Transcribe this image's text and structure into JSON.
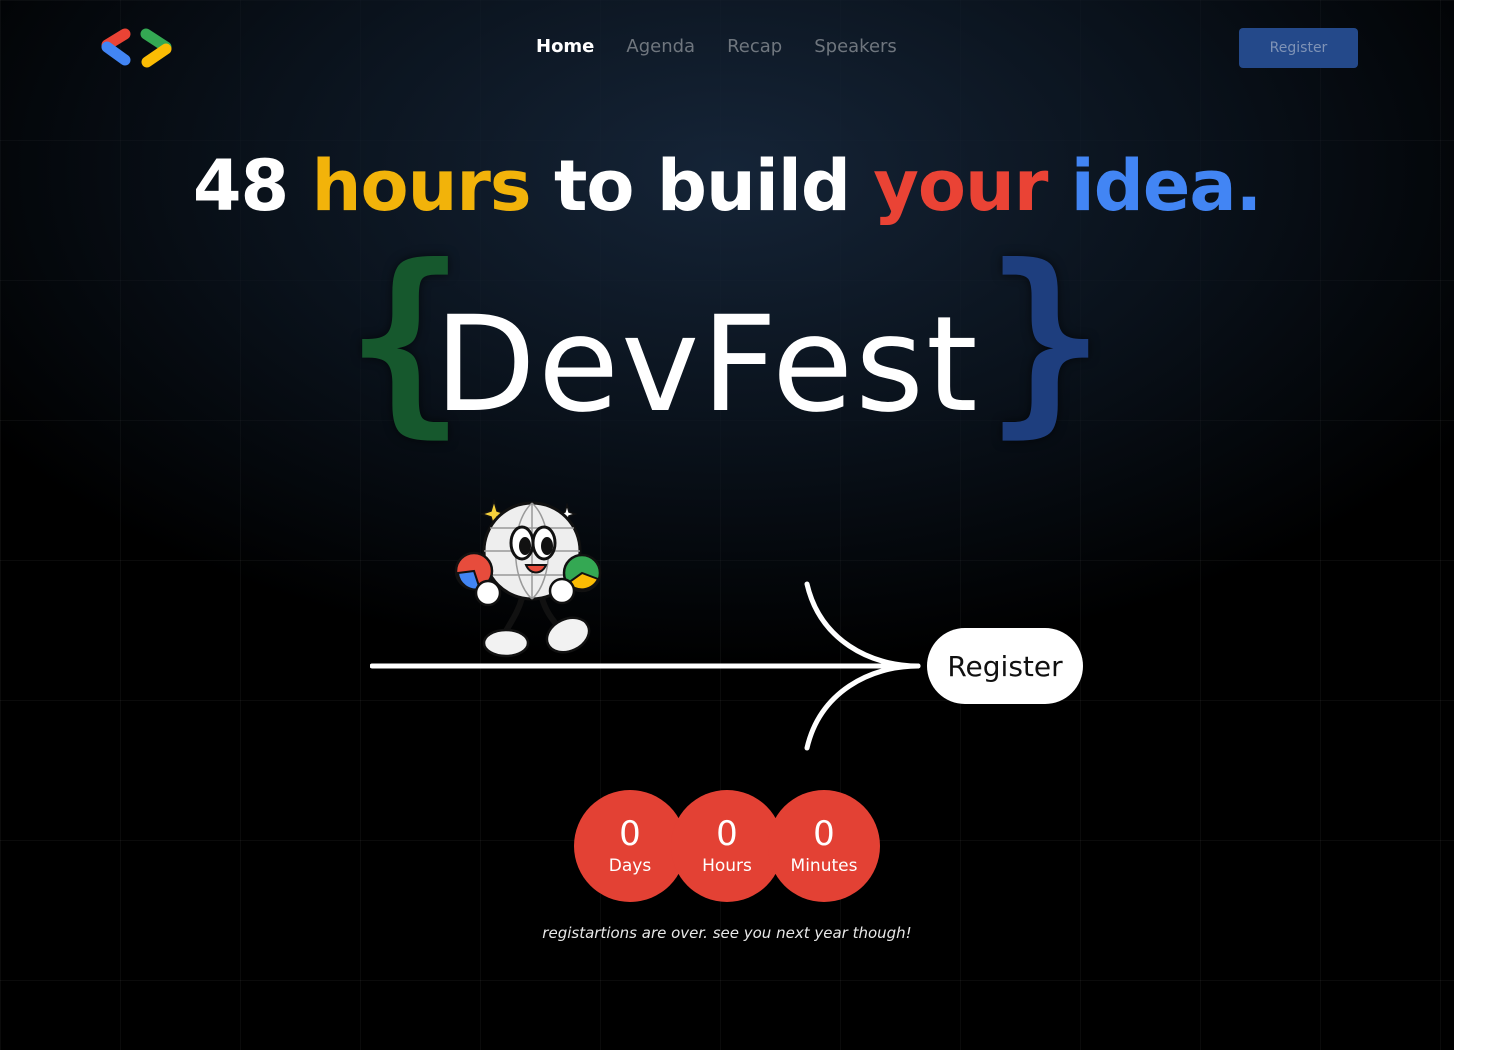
{
  "header": {
    "logo_icon": "gdg-brackets-logo",
    "nav": [
      {
        "label": "Home",
        "active": true
      },
      {
        "label": "Agenda",
        "active": false
      },
      {
        "label": "Recap",
        "active": false
      },
      {
        "label": "Speakers",
        "active": false
      }
    ],
    "register_label": "Register"
  },
  "hero": {
    "headline": {
      "part1": "48 ",
      "part2": "hours",
      "part3": " to build ",
      "part4": "your",
      "part5": " ",
      "part6": "idea."
    },
    "brace_left": "{",
    "brace_right": "}",
    "title": "DevFest",
    "mascot_icon": "globe-mascot-icon",
    "register_label": "Register"
  },
  "countdown": [
    {
      "value": "0",
      "label": "Days"
    },
    {
      "value": "0",
      "label": "Hours"
    },
    {
      "value": "0",
      "label": "Minutes"
    }
  ],
  "closed_note": "registartions are over. see you next year though!",
  "colors": {
    "google_yellow": "#f2b30a",
    "google_red": "#ea4335",
    "google_blue": "#4285f4",
    "google_green": "#34a853",
    "countdown_red": "#e34134",
    "header_button": "#24498a"
  }
}
